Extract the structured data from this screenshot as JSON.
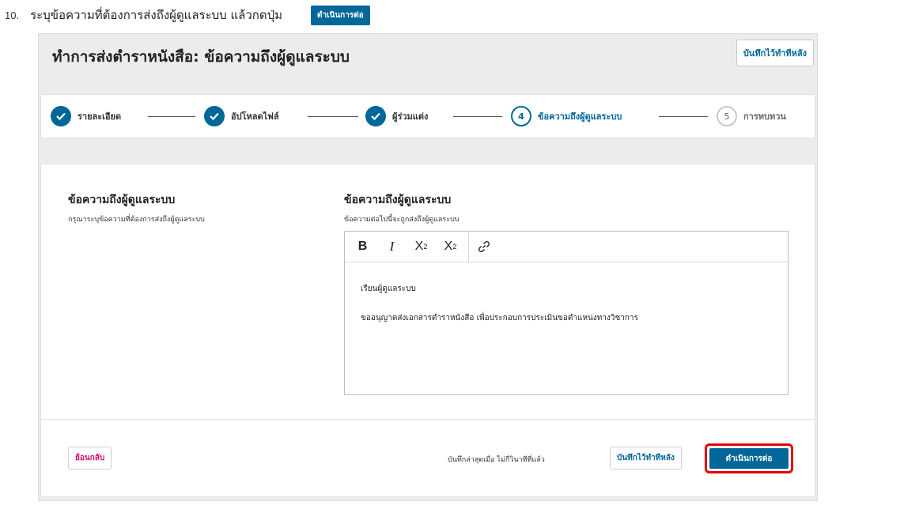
{
  "instruction": {
    "number": "10.",
    "text": "ระบุข้อความที่ต้องการส่งถึงผู้ดูแลระบบ แล้วกดปุ่ม",
    "button_label": "ดำเนินการต่อ"
  },
  "header": {
    "title": "ทำการส่งตำราหนังสือ: ข้อความถึงผู้ดูแลระบบ",
    "save_later_label": "บันทึกไว้ทำทีหลัง"
  },
  "stepper": {
    "steps": [
      {
        "number": "1",
        "label": "รายละเอียด",
        "state": "done"
      },
      {
        "number": "2",
        "label": "อัปโหลดไฟล์",
        "state": "done"
      },
      {
        "number": "3",
        "label": "ผู้ร่วมแต่ง",
        "state": "done"
      },
      {
        "number": "4",
        "label": "ข้อความถึงผู้ดูแลระบบ",
        "state": "current"
      },
      {
        "number": "5",
        "label": "การทบทวน",
        "state": "future"
      }
    ]
  },
  "form": {
    "left_title": "ข้อความถึงผู้ดูแลระบบ",
    "left_desc": "กรุณาระบุข้อความที่ต้องการส่งถึงผู้ดูแลระบบ",
    "right_title": "ข้อความถึงผู้ดูแลระบบ",
    "right_desc": "ข้อความต่อไปนี้จะถูกส่งถึงผู้ดูแลระบบ",
    "toolbar": {
      "bold": "B",
      "italic": "I",
      "superscript": "X",
      "superscript_mark": "2",
      "subscript": "X",
      "subscript_mark": "2",
      "link": "🔗"
    },
    "editor_lines": [
      "เรียนผู้ดูแลระบบ",
      "ขออนุญาตส่งเอกสารตำราหนังสือ เพื่อประกอบการประเมินขอตำแหน่งทางวิชาการ"
    ]
  },
  "footer": {
    "back_label": "ย้อนกลับ",
    "saved_text": "บันทึกล่าสุดเมื่อ ไม่กี่วินาทีที่แล้ว",
    "save_later_label": "บันทึกไว้ทำทีหลัง",
    "continue_label": "ดำเนินการต่อ"
  },
  "colors": {
    "primary": "#006798",
    "back_text": "#d00a6c",
    "highlight": "#e60000"
  },
  "icons": {
    "done": "check-icon",
    "link": "link-icon"
  }
}
